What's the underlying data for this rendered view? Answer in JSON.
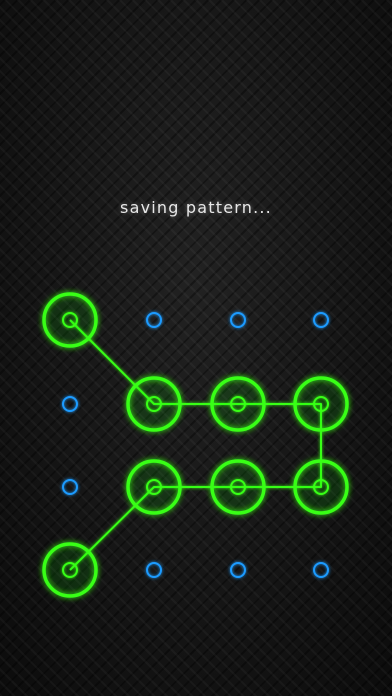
{
  "status_text": "saving pattern...",
  "colors": {
    "active": "#39ff14",
    "inactive": "#1e9bff",
    "path": "#39ff14"
  },
  "pattern": {
    "columns": 4,
    "rows": 4,
    "selected_sequence": [
      [
        1,
        1
      ],
      [
        2,
        2
      ],
      [
        3,
        2
      ],
      [
        4,
        2
      ],
      [
        4,
        3
      ],
      [
        3,
        3
      ],
      [
        2,
        3
      ],
      [
        1,
        4
      ]
    ]
  }
}
